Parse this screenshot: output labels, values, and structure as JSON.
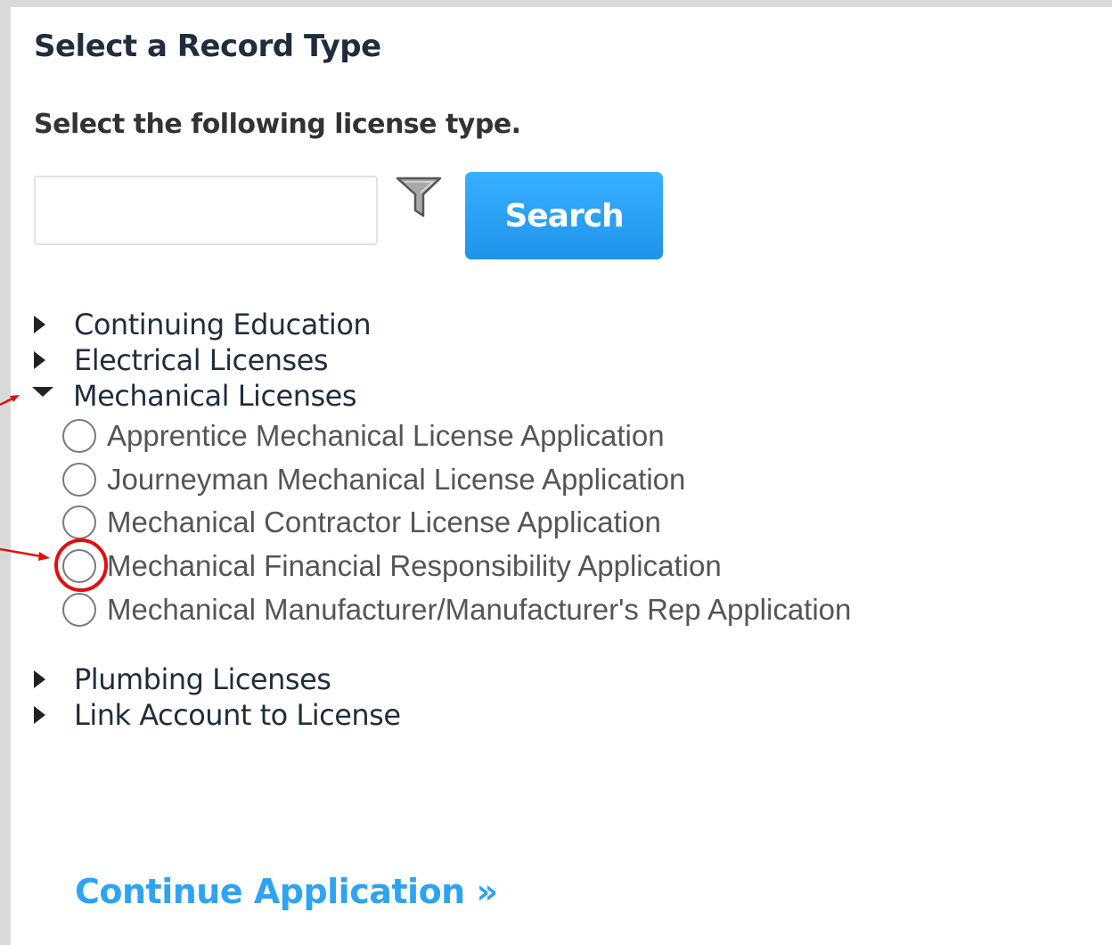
{
  "page": {
    "title": "Select a Record Type",
    "instructions": "Select the following license type."
  },
  "search": {
    "value": "",
    "placeholder": "",
    "button_label": "Search",
    "filter_icon": "filter-icon"
  },
  "categories": [
    {
      "label": "Continuing Education",
      "expanded": false
    },
    {
      "label": "Electrical Licenses",
      "expanded": false
    },
    {
      "label": "Mechanical Licenses",
      "expanded": true,
      "options": [
        {
          "label": "Apprentice Mechanical License Application",
          "selected": false
        },
        {
          "label": "Journeyman Mechanical License Application",
          "selected": false
        },
        {
          "label": "Mechanical Contractor License Application",
          "selected": false
        },
        {
          "label": "Mechanical Financial Responsibility Application",
          "selected": false,
          "highlighted": true
        },
        {
          "label": "Mechanical Manufacturer/Manufacturer's Rep Application",
          "selected": false
        }
      ]
    },
    {
      "label": "Plumbing Licenses",
      "expanded": false
    },
    {
      "label": "Link Account to License",
      "expanded": false
    }
  ],
  "footer": {
    "continue_label": "Continue Application »"
  },
  "colors": {
    "accent": "#2ea3f2",
    "button": "#1f93ea",
    "annotation": "#e01010",
    "heading": "#1f2d3d"
  }
}
